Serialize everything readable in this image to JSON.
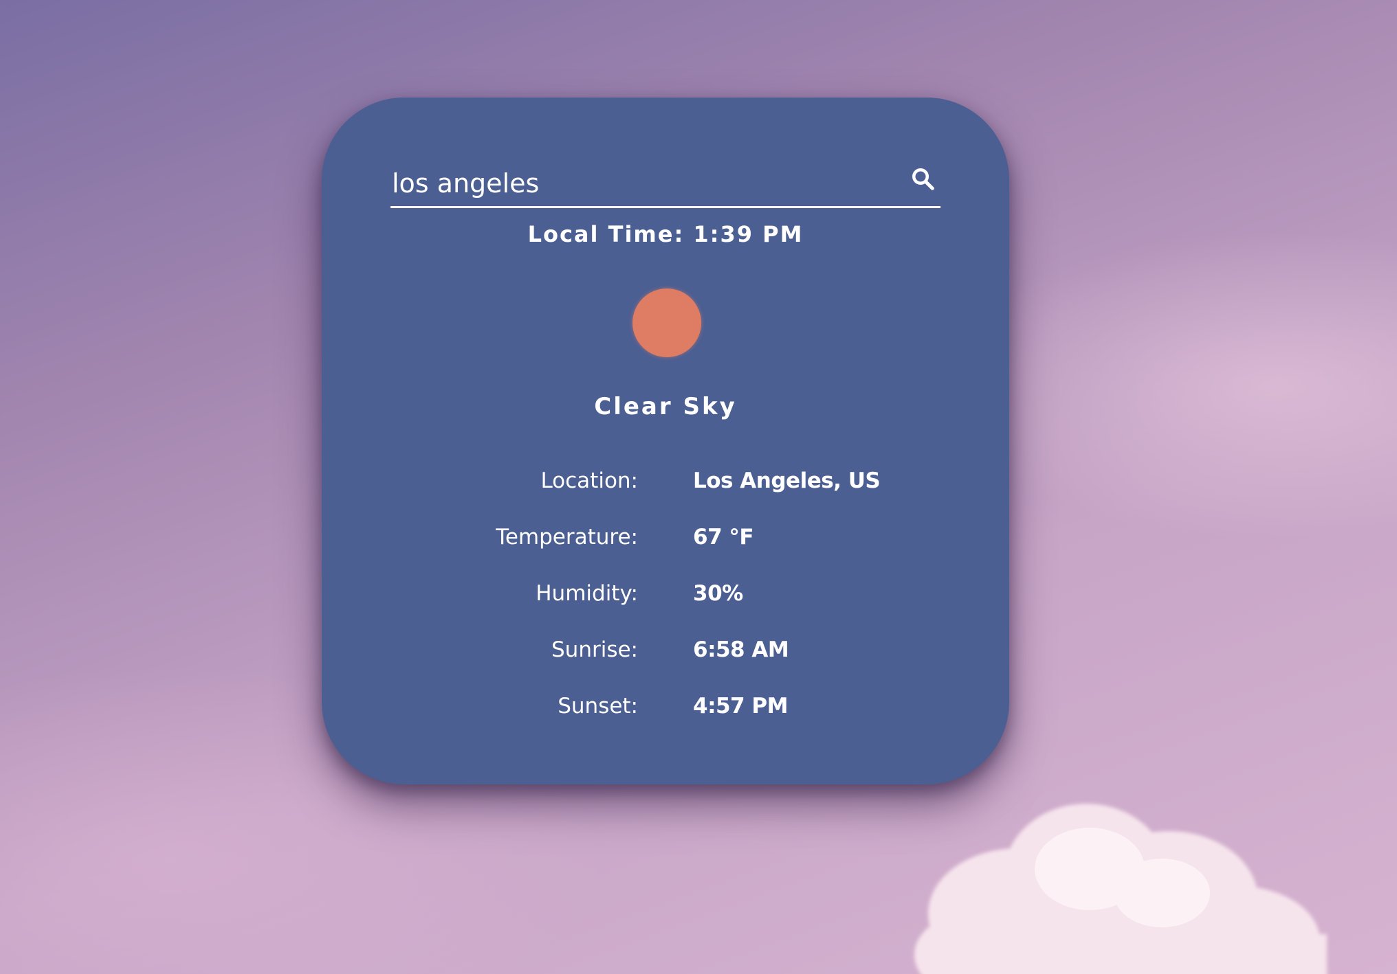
{
  "search": {
    "value": "los angeles",
    "icon": "search-icon"
  },
  "local_time": "Local Time: 1:39 PM",
  "weather_icon": {
    "name": "sun-icon",
    "color": "#de7c64"
  },
  "condition": "Clear Sky",
  "details": [
    {
      "label": "Location:",
      "value": "Los Angeles, US"
    },
    {
      "label": "Temperature:",
      "value": "67 °F"
    },
    {
      "label": "Humidity:",
      "value": "30%"
    },
    {
      "label": "Sunrise:",
      "value": "6:58 AM"
    },
    {
      "label": "Sunset:",
      "value": "4:57 PM"
    }
  ],
  "colors": {
    "card": "#4b5f93",
    "text": "#ffffff",
    "sun": "#de7c64"
  }
}
